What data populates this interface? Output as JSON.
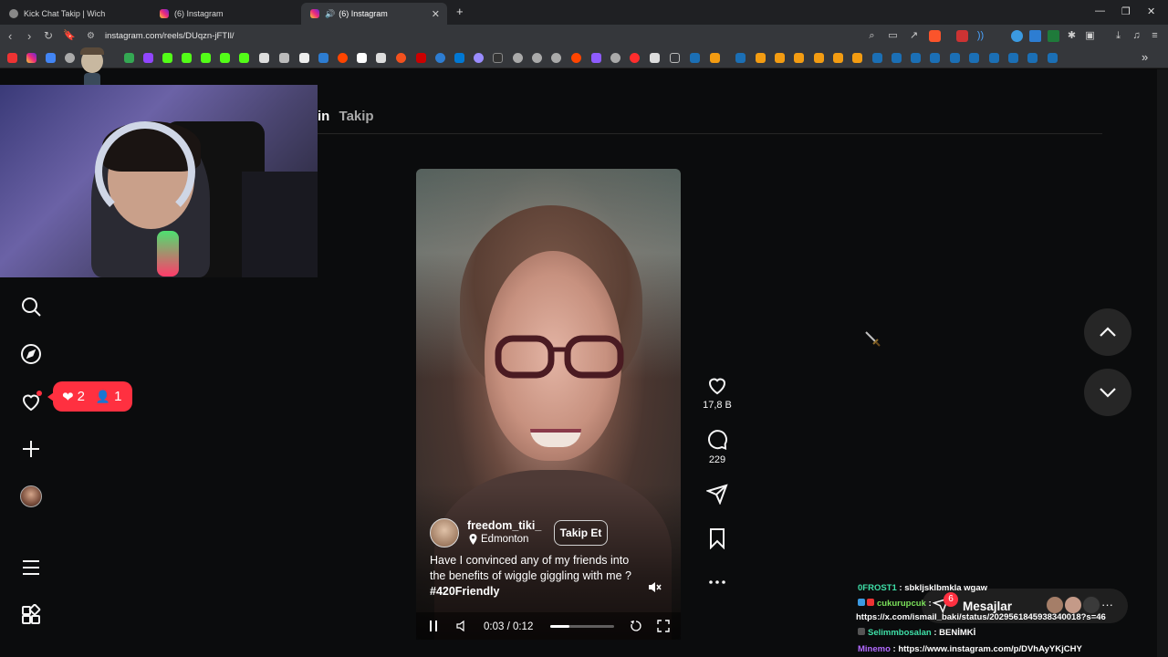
{
  "browser": {
    "tabs": [
      {
        "label": "Kick Chat Takip | Wich",
        "active": false
      },
      {
        "label": "(6) Instagram",
        "active": false
      },
      {
        "label": "(6) Instagram",
        "active": true
      }
    ],
    "url": "instagram.com/reels/DUqzn-jFTIl/",
    "accent": "#1f2023"
  },
  "page": {
    "tabs_text": "Takip",
    "tabs_text_partial": "in"
  },
  "notification": {
    "likes": "2",
    "follows": "1",
    "color": "#ff3040"
  },
  "reel": {
    "author": "freedom_tiki_",
    "location": "Edmonton",
    "follow_label": "Takip Et",
    "caption_text": "Have I convinced any of my friends into the benefits of wiggle giggling with me ? ",
    "caption_tag": "#420Friendly",
    "time": "0:03 / 0:12",
    "progress": 0.3,
    "likes": "17,8 B",
    "comments": "229"
  },
  "chat": {
    "messages_label": "Mesajlar",
    "messages_badge": "6",
    "lines": [
      {
        "user": "0FROST1",
        "text": " : sbkljsklbmkla wgaw",
        "color": "#3fe0a8"
      },
      {
        "user": "cukurupcuk",
        "text": " :",
        "color": "#7be05a"
      },
      {
        "user": "",
        "text": "https://x.com/ismail_baki/status/2029561845938340018?s=46",
        "color": "#ffffff"
      },
      {
        "user": "Selimmbosalan",
        "text": " : BENİMKİ",
        "color": "#3fe0a8"
      },
      {
        "user": "Minemo",
        "text": " : https://www.instagram.com/p/DVhAyYKjCHY",
        "color": "#b36bff"
      }
    ]
  }
}
